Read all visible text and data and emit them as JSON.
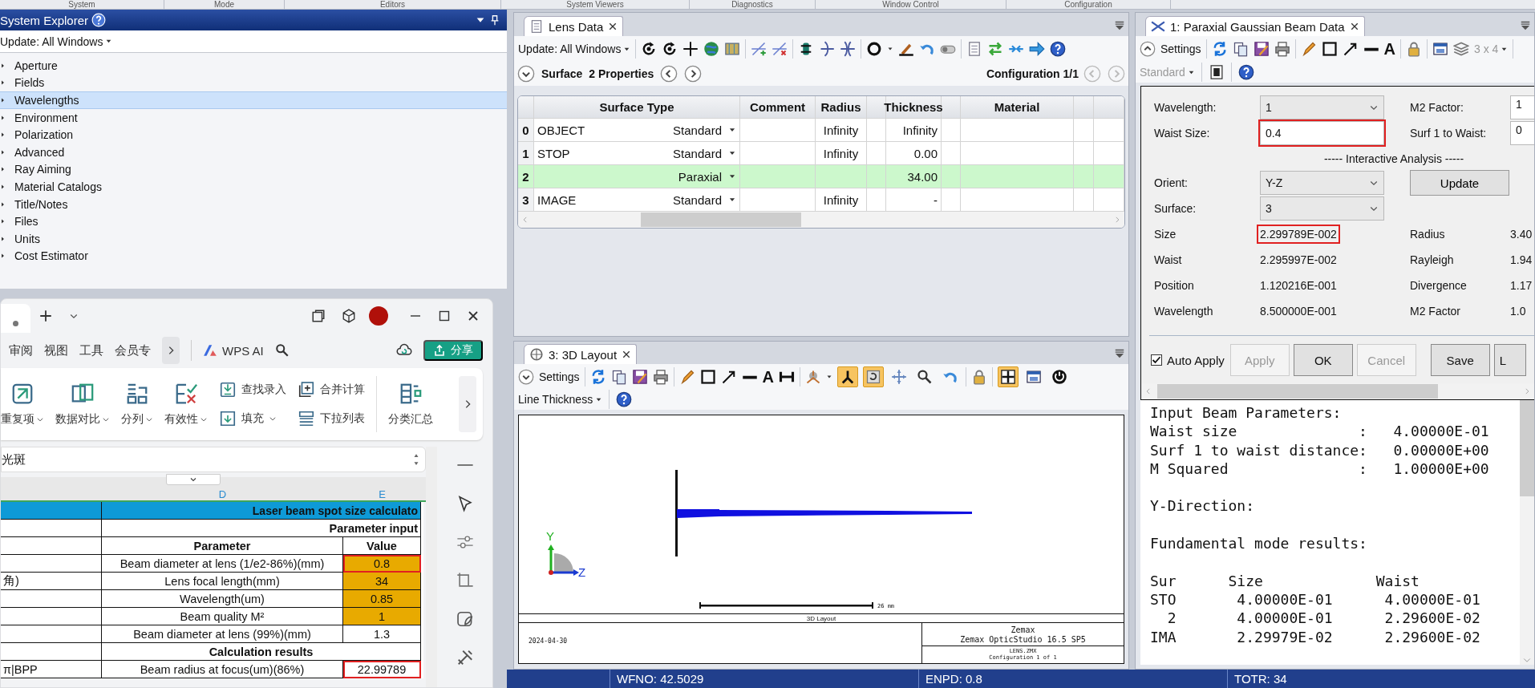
{
  "ribbon_groups": [
    "System",
    "Mode",
    "Editors",
    "System Viewers",
    "Diagnostics",
    "Window Control",
    "Configuration"
  ],
  "system_explorer": {
    "title": "System Explorer",
    "update": "Update: All Windows",
    "items": [
      {
        "label": "Aperture",
        "selected": false
      },
      {
        "label": "Fields",
        "selected": false
      },
      {
        "label": "Wavelengths",
        "selected": true
      },
      {
        "label": "Environment",
        "selected": false
      },
      {
        "label": "Polarization",
        "selected": false
      },
      {
        "label": "Advanced",
        "selected": false
      },
      {
        "label": "Ray Aiming",
        "selected": false
      },
      {
        "label": "Material Catalogs",
        "selected": false
      },
      {
        "label": "Title/Notes",
        "selected": false
      },
      {
        "label": "Files",
        "selected": false
      },
      {
        "label": "Units",
        "selected": false
      },
      {
        "label": "Cost Estimator",
        "selected": false
      }
    ]
  },
  "spreadsheet": {
    "menu": [
      "审阅",
      "视图",
      "工具",
      "会员专"
    ],
    "ai": "WPS AI",
    "share": "分享",
    "ribbon": [
      {
        "kind": "large",
        "label": "重复项",
        "dropdown": true
      },
      {
        "kind": "large",
        "label": "数据对比",
        "dropdown": true
      },
      {
        "kind": "large",
        "label": "分列",
        "dropdown": true
      },
      {
        "kind": "large",
        "label": "有效性",
        "dropdown": true
      },
      {
        "kind": "small",
        "label": "查找录入",
        "dropdown": false
      },
      {
        "kind": "small",
        "label": "填充",
        "dropdown": true
      },
      {
        "kind": "small",
        "label": "合并计算",
        "dropdown": false
      },
      {
        "kind": "small",
        "label": "下拉列表",
        "dropdown": false
      },
      {
        "kind": "large",
        "label": "分类汇总",
        "dropdown": false
      }
    ],
    "formula": "光斑",
    "columns": [
      "D",
      "E"
    ],
    "rows": [
      {
        "kind": "title",
        "text": "Laser beam spot size calculato"
      },
      {
        "kind": "section",
        "text": "Parameter input"
      },
      {
        "kind": "header",
        "param": "Parameter",
        "value": "Value"
      },
      {
        "kind": "data",
        "param": "Beam diameter at lens (1/e2-86%)(mm)",
        "value": "0.8",
        "input": true,
        "highlighted": true
      },
      {
        "kind": "data",
        "side": "角)",
        "param": "Lens focal length(mm)",
        "value": "34",
        "input": true,
        "highlighted": false
      },
      {
        "kind": "data",
        "param": "Wavelength(um)",
        "value": "0.85",
        "input": true,
        "highlighted": false
      },
      {
        "kind": "data",
        "param": "Beam quality M²",
        "value": "1",
        "input": true,
        "highlighted": false
      },
      {
        "kind": "data",
        "param": "Beam diameter at lens (99%)(mm)",
        "value": "1.3",
        "input": false,
        "highlighted": false
      },
      {
        "kind": "group",
        "text": "Calculation results"
      },
      {
        "kind": "data",
        "side": "π|BPP",
        "param": "Beam radius at focus(um)(86%)",
        "value": "22.99789",
        "input": false,
        "highlighted": true
      }
    ]
  },
  "lens_data": {
    "tab": "Lens Data",
    "update": "Update: All Windows",
    "surface": "Surface",
    "properties": "2 Properties",
    "configuration": "Configuration 1/1",
    "columns": [
      "Surface Type",
      "Comment",
      "Radius",
      "Thickness",
      "Material"
    ],
    "rows": [
      {
        "num": "0",
        "name": "OBJECT",
        "type": "Standard",
        "radius": "Infinity",
        "thickness": "Infinity",
        "selected": false
      },
      {
        "num": "1",
        "name": "STOP",
        "type": "Standard",
        "radius": "Infinity",
        "thickness": "0.00",
        "selected": false
      },
      {
        "num": "2",
        "type": "Paraxial",
        "thickness": "34.00",
        "selected": true
      },
      {
        "num": "3",
        "name": "IMAGE",
        "type": "Standard",
        "radius": "Infinity",
        "thickness": "-",
        "selected": false
      }
    ]
  },
  "layout": {
    "tab": "3: 3D Layout",
    "settings": "Settings",
    "text_tool": "A",
    "line_thickness": "Line Thickness",
    "toggles": [
      {
        "on": true
      },
      {
        "on": true
      },
      {
        "on": false
      },
      {
        "on": false
      },
      {
        "on": false
      },
      {
        "on": true
      },
      {
        "on": false
      },
      {
        "on": false
      }
    ],
    "axis_labels": [
      "Y",
      "Z"
    ],
    "scale": "26 mm",
    "plot_title": "3D Layout",
    "date": "2024-04-30",
    "company": "Zemax",
    "product": "Zemax OpticStudio 16.5 SP5",
    "file": "LENS.ZMX",
    "configuration": "Configuration 1 of 1"
  },
  "beam": {
    "tab": "1: Paraxial Gaussian Beam Data",
    "settings": "Settings",
    "text_tool": "A",
    "grid_size": {
      "label": "3 x 4",
      "disabled": true
    },
    "style": {
      "label": "Standard",
      "disabled": true
    },
    "fields": [
      {
        "label": "Wavelength:",
        "kind": "dropdown",
        "value": "1",
        "highlighted": false,
        "label2": "M2 Factor:",
        "value2": "1"
      },
      {
        "label": "Waist Size:",
        "kind": "input",
        "value": "0.4",
        "highlighted": true,
        "label2": "Surf 1 to Waist:",
        "value2": "0"
      }
    ],
    "section": "----- Interactive Analysis -----",
    "analysis": [
      {
        "label": "Orient:",
        "value": "Y-Z"
      },
      {
        "label": "Surface:",
        "value": "3"
      }
    ],
    "update": "Update",
    "results": [
      {
        "label": "Size",
        "value": "2.299789E-002",
        "highlighted": true,
        "label2": "Radius",
        "value2": "3.40"
      },
      {
        "label": "Waist",
        "value": "2.295997E-002",
        "highlighted": false,
        "label2": "Rayleigh",
        "value2": "1.94"
      },
      {
        "label": "Position",
        "value": "1.120216E-001",
        "highlighted": false,
        "label2": "Divergence",
        "value2": "1.17"
      },
      {
        "label": "Wavelength",
        "value": "8.500000E-001",
        "highlighted": false,
        "label2": "M2 Factor",
        "value2": "1.0"
      }
    ],
    "auto_apply": {
      "label": "Auto Apply",
      "checked": true
    },
    "buttons": [
      {
        "label": "Apply",
        "disabled": true
      },
      {
        "label": "OK",
        "disabled": false
      },
      {
        "label": "Cancel",
        "disabled": true
      },
      {
        "label": "Save",
        "disabled": false
      },
      {
        "label": "L",
        "disabled": false
      }
    ],
    "output": [
      [
        "Input Beam Parameters:",
        "Waist size              :   4.00000E-01",
        "Surf 1 to waist distance:   0.00000E+00",
        "M Squared               :   1.00000E+00"
      ],
      [
        "Y-Direction:"
      ],
      [
        "Fundamental mode results:"
      ],
      [
        "Sur      Size             Waist",
        "STO       4.00000E-01      4.00000E-01",
        "  2       4.00000E-01      2.29600E-02",
        "IMA       2.29979E-02      2.29600E-02"
      ]
    ]
  },
  "status_bar": [
    "WFNO: 42.5029",
    "ENPD: 0.8",
    "TOTR: 34"
  ]
}
